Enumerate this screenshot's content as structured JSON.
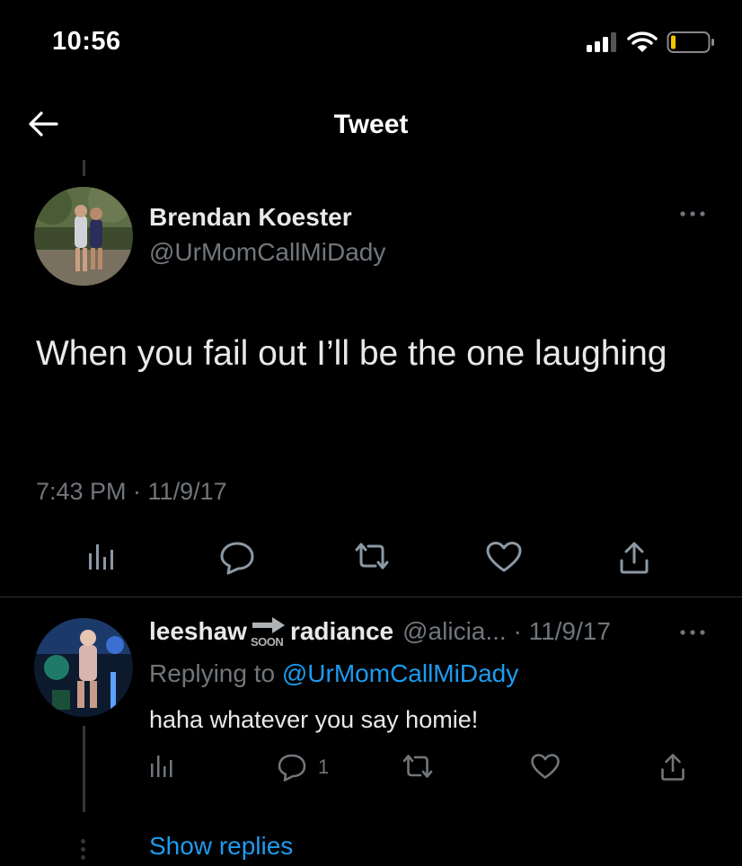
{
  "status_bar": {
    "time": "10:56"
  },
  "nav": {
    "title": "Tweet"
  },
  "main_tweet": {
    "author_name": "Brendan Koester",
    "author_handle": "@UrMomCallMiDady",
    "text": "When you fail out I’ll be the one laughing",
    "timestamp": "7:43 PM · 11/9/17"
  },
  "reply": {
    "name_part1": "leeshaw",
    "badge_text": "SOON",
    "name_part2": "radiance",
    "handle_date": "@alicia... · 11/9/17",
    "replying_prefix": "Replying to ",
    "replying_mention": "@UrMomCallMiDady",
    "text": "haha whatever you say homie!",
    "reply_count": "1"
  },
  "thread": {
    "show_replies": "Show replies"
  },
  "colors": {
    "accent": "#1d9bf0",
    "background": "#000000",
    "secondary_text": "#71767b",
    "primary_text": "#e7e9ea"
  }
}
